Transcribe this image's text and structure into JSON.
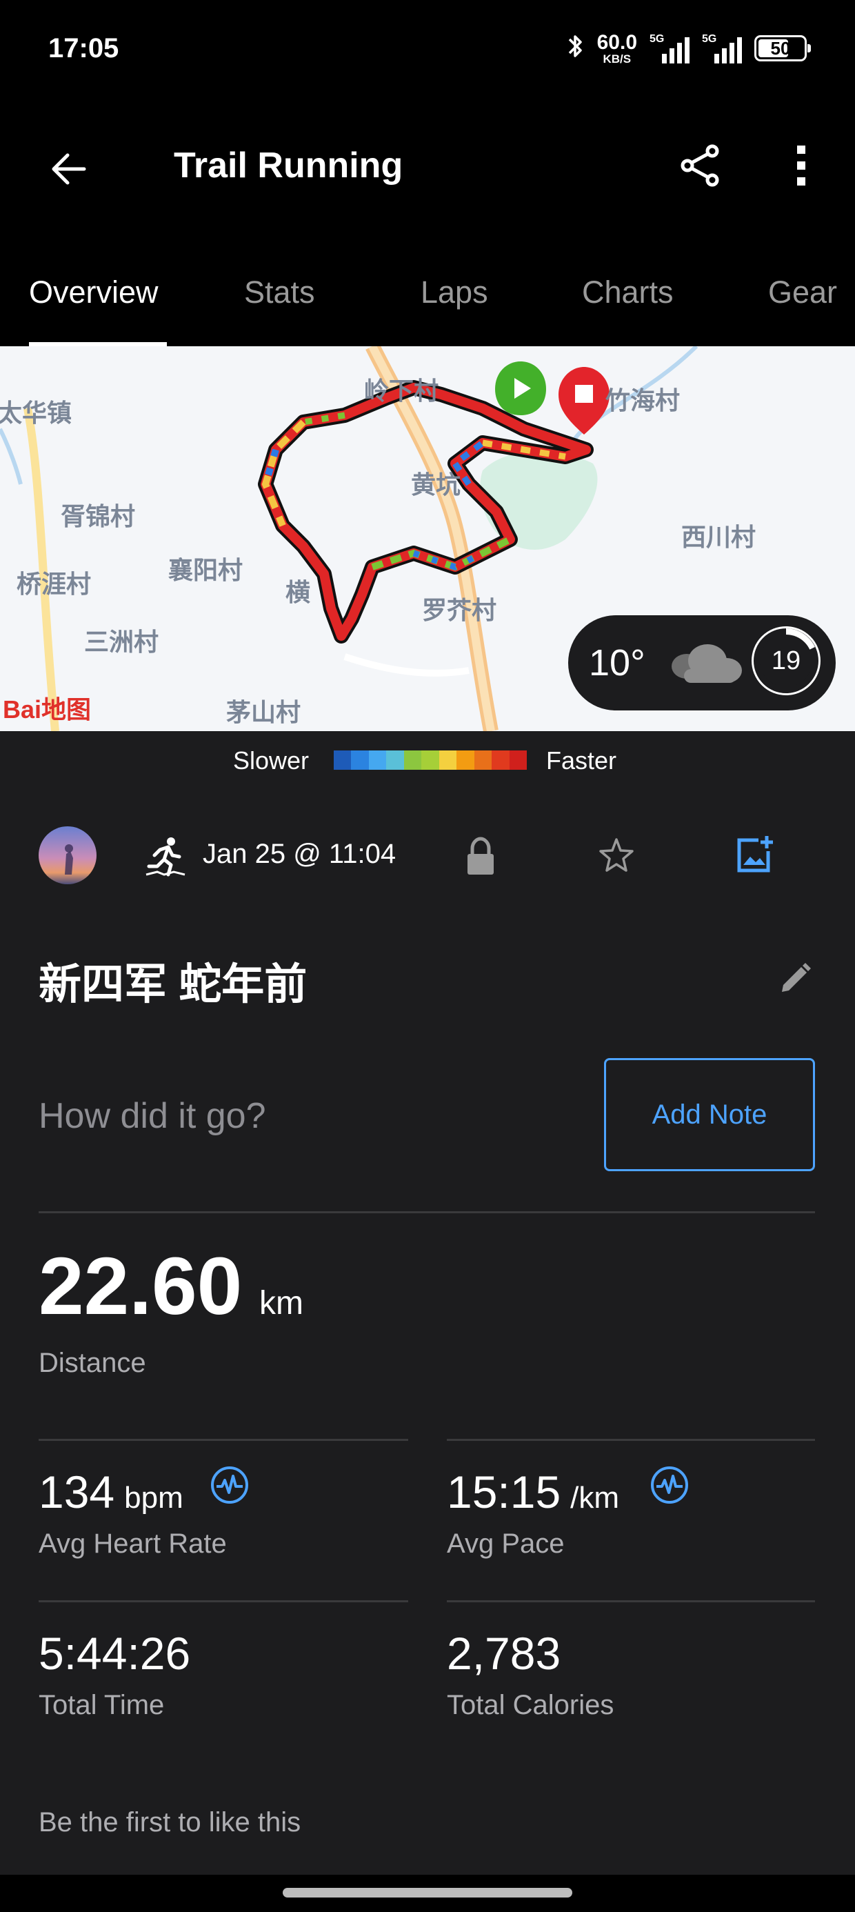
{
  "status_bar": {
    "time": "17:05",
    "net_speed_value": "60.0",
    "net_speed_unit": "KB/S",
    "signal1_label": "5G",
    "signal2_label": "5G",
    "battery": "50",
    "icons": [
      "bluetooth-icon",
      "signal-icon",
      "signal-icon",
      "battery-icon"
    ]
  },
  "app_bar": {
    "title": "Trail Running",
    "icons": [
      "back-arrow-icon",
      "share-icon",
      "more-vert-icon"
    ]
  },
  "tabs": [
    {
      "label": "Overview",
      "active": true
    },
    {
      "label": "Stats",
      "active": false
    },
    {
      "label": "Laps",
      "active": false
    },
    {
      "label": "Charts",
      "active": false
    },
    {
      "label": "Gear",
      "active": false
    }
  ],
  "map": {
    "places": [
      "太华镇",
      "岭下村",
      "竹海村",
      "胥锦村",
      "黄坑",
      "西川村",
      "桥涯村",
      "襄阳村",
      "横",
      "罗芥村",
      "三洲村",
      "茅山村"
    ],
    "provider_logo": "Bai地图",
    "weather_temp": "10°",
    "weather_icon": "cloud-icon",
    "aqi_value": "19",
    "route_colors": [
      "#e02626",
      "#f5c542",
      "#7cc534",
      "#2c7be5",
      "#1a1a1a"
    ]
  },
  "legend": {
    "slower_label": "Slower",
    "faster_label": "Faster",
    "gradient": [
      "#1e5bb8",
      "#2b83e0",
      "#45a8f0",
      "#5ac0d8",
      "#8cc63f",
      "#a6cf38",
      "#f4d03f",
      "#f39c12",
      "#e8701a",
      "#e03a1e",
      "#d0201c"
    ]
  },
  "activity": {
    "date": "Jan 25 @ 11:04",
    "name": "新四军 蛇年前",
    "note_placeholder": "How did it go?",
    "add_note_label": "Add Note",
    "icons": [
      "avatar",
      "trail-run-icon",
      "lock-icon",
      "star-icon",
      "add-photo-icon",
      "edit-pencil-icon"
    ]
  },
  "stats": {
    "distance": {
      "value": "22.60",
      "unit": "km",
      "label": "Distance"
    },
    "heart_rate": {
      "value": "134",
      "unit": "bpm",
      "label": "Avg Heart Rate"
    },
    "pace": {
      "value": "15:15",
      "unit": "/km",
      "label": "Avg Pace"
    },
    "total_time": {
      "value": "5:44:26",
      "label": "Total Time"
    },
    "calories": {
      "value": "2,783",
      "label": "Total Calories"
    }
  },
  "social": {
    "likes_text": "Be the first to like this"
  },
  "colors": {
    "accent": "#4da3ff",
    "background": "#1c1c1e",
    "header": "#000000",
    "muted_text": "#aeaeb2"
  }
}
